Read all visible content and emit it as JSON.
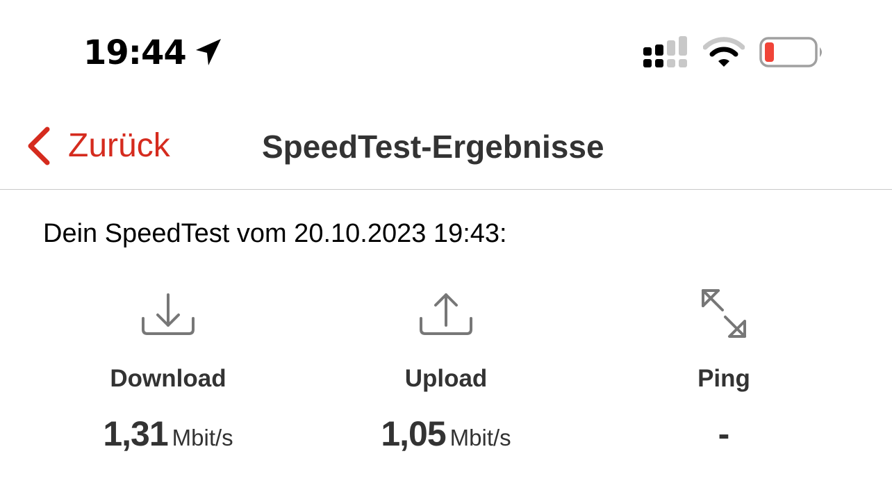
{
  "status_bar": {
    "time": "19:44",
    "icons": [
      "location-arrow-icon",
      "cellular-signal-icon",
      "wifi-icon",
      "battery-low-icon"
    ],
    "battery_color": "#f04438"
  },
  "nav": {
    "back_label": "Zurück",
    "title": "SpeedTest-Ergebnisse",
    "accent_color": "#d52b1e"
  },
  "result": {
    "subtitle": "Dein SpeedTest vom 20.10.2023 19:43:"
  },
  "metrics": {
    "download": {
      "label": "Download",
      "value": "1,31",
      "unit": "Mbit/s",
      "icon": "download-icon"
    },
    "upload": {
      "label": "Upload",
      "value": "1,05",
      "unit": "Mbit/s",
      "icon": "upload-icon"
    },
    "ping": {
      "label": "Ping",
      "value": "-",
      "icon": "ping-arrows-icon"
    }
  }
}
